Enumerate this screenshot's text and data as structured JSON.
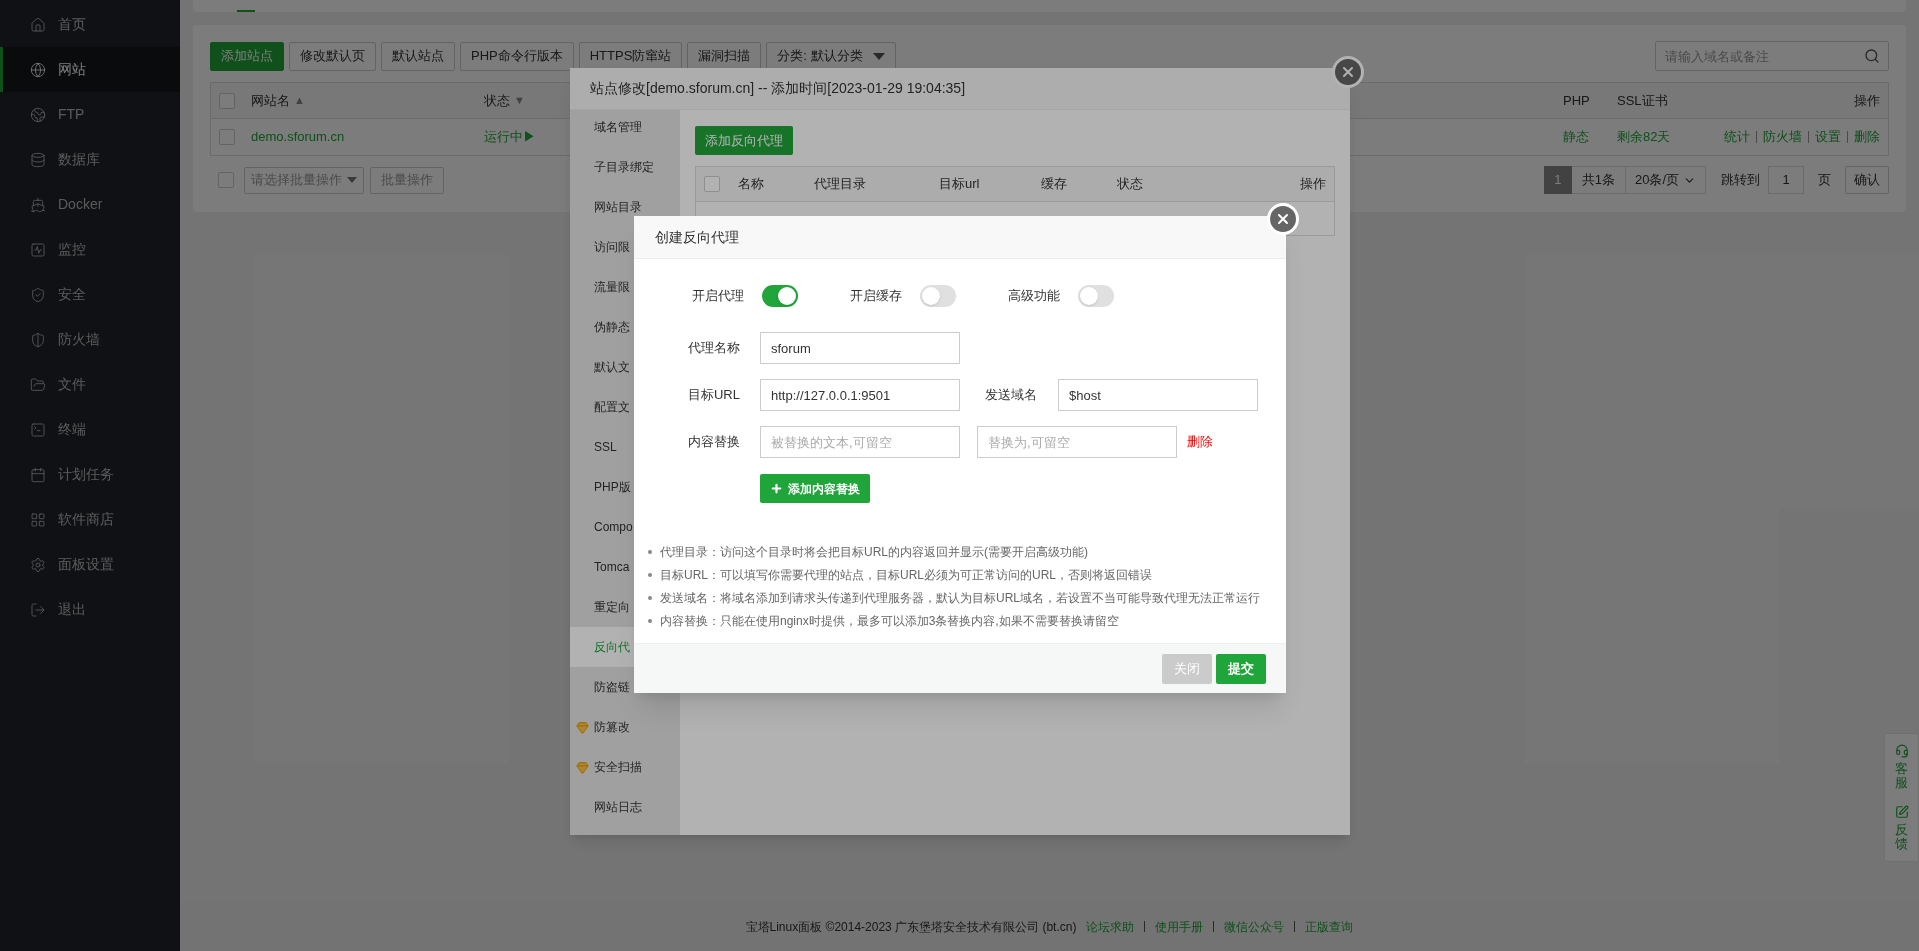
{
  "sidebar": {
    "items": [
      {
        "label": "首页",
        "selected": false
      },
      {
        "label": "网站",
        "selected": true
      },
      {
        "label": "FTP",
        "selected": false
      },
      {
        "label": "数据库",
        "selected": false
      },
      {
        "label": "Docker",
        "selected": false
      },
      {
        "label": "监控",
        "selected": false
      },
      {
        "label": "安全",
        "selected": false
      },
      {
        "label": "防火墙",
        "selected": false
      },
      {
        "label": "文件",
        "selected": false
      },
      {
        "label": "终端",
        "selected": false
      },
      {
        "label": "计划任务",
        "selected": false
      },
      {
        "label": "软件商店",
        "selected": false
      },
      {
        "label": "面板设置",
        "selected": false
      },
      {
        "label": "退出",
        "selected": false
      }
    ]
  },
  "toolbar": {
    "buttons": [
      {
        "label": "添加站点",
        "kind": "primary"
      },
      {
        "label": "修改默认页",
        "kind": "default"
      },
      {
        "label": "默认站点",
        "kind": "default"
      },
      {
        "label": "PHP命令行版本",
        "kind": "default"
      },
      {
        "label": "HTTPS防窜站",
        "kind": "default"
      },
      {
        "label": "漏洞扫描",
        "kind": "default"
      }
    ],
    "category_select": {
      "value": "分类: 默认分类"
    },
    "search": {
      "placeholder": "请输入域名或备注"
    }
  },
  "sites_table": {
    "header_checked": false,
    "columns": [
      {
        "label": "网站名",
        "sort_mark": "▲"
      },
      {
        "label": "状态",
        "sort_mark": "▼"
      },
      {
        "label": "PHP"
      },
      {
        "label": "SSL证书"
      },
      {
        "label": "操作"
      }
    ],
    "rows": [
      {
        "checked": false,
        "name": "demo.sforum.cn",
        "status": "运行中▶",
        "php": "静态",
        "ssl": "剩余82天",
        "actions": [
          "统计",
          "防火墙",
          "设置",
          "删除"
        ]
      }
    ]
  },
  "batch": {
    "checked": false,
    "select_placeholder": "请选择批量操作",
    "button": "批量操作"
  },
  "pagination": {
    "pages": [
      {
        "label": "1",
        "selected": true
      }
    ],
    "total": "共1条",
    "page_size": "20条/页",
    "jump_label": "跳转到",
    "jump_value": "1",
    "page_unit": "页",
    "confirm": "确认"
  },
  "footer": {
    "text": "宝塔Linux面板 ©2014-2023 广东堡塔安全技术有限公司 (bt.cn)",
    "links": [
      "论坛求助",
      "使用手册",
      "微信公众号",
      "正版查询"
    ]
  },
  "float_widget": [
    {
      "label": "客服"
    },
    {
      "label": "反馈"
    }
  ],
  "site_dialog": {
    "title": "站点修改[demo.sforum.cn] -- 添加时间[2023-01-29 19:04:35]",
    "menu": [
      {
        "label": "域名管理",
        "selected": false,
        "kind": "plain"
      },
      {
        "label": "子目录绑定",
        "selected": false,
        "kind": "plain"
      },
      {
        "label": "网站目录",
        "selected": false,
        "kind": "plain"
      },
      {
        "label": "访问限",
        "selected": false,
        "kind": "plain"
      },
      {
        "label": "流量限",
        "selected": false,
        "kind": "plain"
      },
      {
        "label": "伪静态",
        "selected": false,
        "kind": "plain"
      },
      {
        "label": "默认文",
        "selected": false,
        "kind": "plain"
      },
      {
        "label": "配置文",
        "selected": false,
        "kind": "plain"
      },
      {
        "label": "SSL",
        "selected": false,
        "kind": "plain"
      },
      {
        "label": "PHP版",
        "selected": false,
        "kind": "plain"
      },
      {
        "label": "Compo",
        "selected": false,
        "kind": "plain"
      },
      {
        "label": "Tomca",
        "selected": false,
        "kind": "plain"
      },
      {
        "label": "重定向",
        "selected": false,
        "kind": "plain"
      },
      {
        "label": "反向代",
        "selected": true,
        "kind": "plain"
      },
      {
        "label": "防盗链",
        "selected": false,
        "kind": "plain"
      },
      {
        "label": "防篡改",
        "selected": false,
        "kind": "pro"
      },
      {
        "label": "安全扫描",
        "selected": false,
        "kind": "pro"
      },
      {
        "label": "网站日志",
        "selected": false,
        "kind": "plain"
      }
    ],
    "add_button": "添加反向代理",
    "table": {
      "header_checked": false,
      "columns": [
        "名称",
        "代理目录",
        "目标url",
        "缓存",
        "状态",
        "操作"
      ]
    }
  },
  "proxy_dialog": {
    "title": "创建反向代理",
    "switches": [
      {
        "label": "开启代理",
        "on": true
      },
      {
        "label": "开启缓存",
        "on": false
      },
      {
        "label": "高级功能",
        "on": false
      }
    ],
    "name": {
      "label": "代理名称",
      "value": "sforum"
    },
    "target": {
      "label": "目标URL",
      "value": "http://127.0.0.1:9501"
    },
    "send_domain": {
      "label": "发送域名",
      "value": "$host"
    },
    "replace": {
      "label": "内容替换",
      "from_placeholder": "被替换的文本,可留空",
      "to_placeholder": "替换为,可留空",
      "delete": "删除"
    },
    "add_replace_button": "添加内容替换",
    "notes": [
      "代理目录：访问这个目录时将会把目标URL的内容返回并显示(需要开启高级功能)",
      "目标URL：可以填写你需要代理的站点，目标URL必须为可正常访问的URL，否则将返回错误",
      "发送域名：将域名添加到请求头传递到代理服务器，默认为目标URL域名，若设置不当可能导致代理无法正常运行",
      "内容替换：只能在使用nginx时提供，最多可以添加3条替换内容,如果不需要替换请留空"
    ],
    "buttons": [
      {
        "label": "关闭",
        "kind": "secondary"
      },
      {
        "label": "提交",
        "kind": "primary"
      }
    ]
  }
}
